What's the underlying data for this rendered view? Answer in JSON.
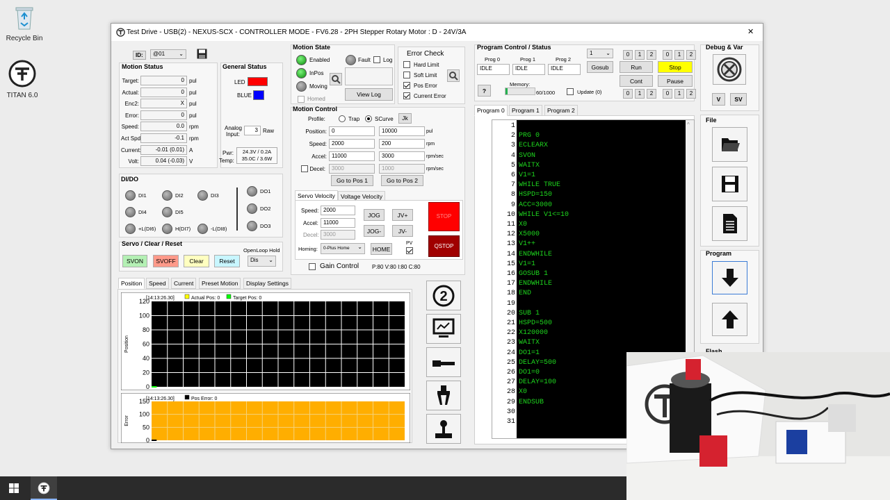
{
  "desktop": {
    "recycle_bin": "Recycle Bin",
    "titan": "TITAN 6.0"
  },
  "window": {
    "title": "Test Drive - USB(2) - NEXUS-SCX - CONTROLLER MODE - FV6.28 -  2PH Stepper Rotary Motor : D - 24V/3A",
    "close_glyph": "✕"
  },
  "id_box": {
    "label": "ID:",
    "value": "@01"
  },
  "motion_status": {
    "title": "Motion Status",
    "rows": [
      {
        "label": "Target:",
        "value": "0",
        "unit": "pul"
      },
      {
        "label": "Actual:",
        "value": "0",
        "unit": "pul"
      },
      {
        "label": "Enc2:",
        "value": "X",
        "unit": "pul"
      },
      {
        "label": "Error:",
        "value": "0",
        "unit": "pul"
      },
      {
        "label": "Speed:",
        "value": "0.0",
        "unit": "rpm"
      },
      {
        "label": "Act Spd:",
        "value": "-0.1",
        "unit": "rpm"
      },
      {
        "label": "Current:",
        "value": "-0.01 (0.01)",
        "unit": "A"
      },
      {
        "label": "Volt:",
        "value": "0.04 (-0.03)",
        "unit": "V"
      }
    ]
  },
  "general_status": {
    "title": "General Status",
    "led_label": "LED",
    "blue_label": "BLUE",
    "led_color": "#ff0000",
    "blue_color": "#0000ff",
    "analog_label": "Analog Input:",
    "analog_value": "3",
    "analog_unit": "Raw",
    "pwr_label": "Pwr:",
    "temp_label": "Temp:",
    "pwr_value": "24.3V / 0.2A",
    "temp_value": "35.0C / 3.6W"
  },
  "dido": {
    "title": "DI/DO",
    "inputs": [
      "DI1",
      "DI2",
      "DI3",
      "DI4",
      "DI5",
      "+L(DI6)",
      "H(DI7)",
      "-L(DI8)"
    ],
    "outputs": [
      "DO1",
      "DO2",
      "DO3"
    ]
  },
  "servo": {
    "title": "Servo / Clear / Reset",
    "svon": "SVON",
    "svoff": "SVOFF",
    "clear": "Clear",
    "reset": "Reset",
    "openloop_label": "OpenLoop Hold",
    "openloop_value": "Dis"
  },
  "motion_state": {
    "title": "Motion State",
    "enabled": "Enabled",
    "inpos": "InPos",
    "moving": "Moving",
    "homed": "Homed",
    "fault": "Fault",
    "log": "Log",
    "view_log": "View Log"
  },
  "error_check": {
    "title": "Error Check",
    "items": [
      {
        "label": "Hard Limit",
        "checked": false
      },
      {
        "label": "Soft Limit",
        "checked": false
      },
      {
        "label": "Pos Error",
        "checked": true
      },
      {
        "label": "Current Error",
        "checked": true
      }
    ]
  },
  "motion_control": {
    "title": "Motion Control",
    "profile_label": "Profile:",
    "trap": "Trap",
    "scurve": "SCurve",
    "jk": "Jk",
    "rows": [
      {
        "label": "Position:",
        "v1": "0",
        "v2": "10000",
        "unit": "pul"
      },
      {
        "label": "Speed:",
        "v1": "2000",
        "v2": "200",
        "unit": "rpm"
      },
      {
        "label": "Accel:",
        "v1": "11000",
        "v2": "3000",
        "unit": "rpm/sec"
      },
      {
        "label": "Decel:",
        "v1": "3000",
        "v2": "1000",
        "unit": "rpm/sec"
      }
    ],
    "goto1": "Go to Pos 1",
    "goto2": "Go to Pos 2"
  },
  "velocity": {
    "tab_servo": "Servo Velocity",
    "tab_voltage": "Voltage Velocity",
    "speed_label": "Speed:",
    "speed_value": "2000",
    "accel_label": "Accel:",
    "accel_value": "11000",
    "decel_label": "Decel:",
    "decel_value": "3000",
    "jog": "JOG",
    "jog_neg": "JOG-",
    "jv_pos": "JV+",
    "jv_neg": "JV-",
    "homing_label": "Homing:",
    "homing_value": "0-Plus Home",
    "home": "HOME",
    "pv": "PV",
    "stop": "STOP",
    "qstop": "QSTOP",
    "gain_control": "Gain Control",
    "pid": "P:80 V:80 I:80 C:80"
  },
  "chart_tabs": [
    "Position",
    "Speed",
    "Current",
    "Preset Motion",
    "Display Settings"
  ],
  "chart_data": [
    {
      "type": "line",
      "title": "[14:13:26.30]",
      "ylabel": "Position",
      "ylim": [
        0,
        120
      ],
      "yticks": [
        "120",
        "100",
        "80",
        "60",
        "40",
        "20",
        "0"
      ],
      "series": [
        {
          "name": "Actual Pos: 0",
          "color": "#ffff00",
          "values": [
            0,
            0
          ]
        },
        {
          "name": "Target Pos: 0",
          "color": "#00ff00",
          "values": [
            0,
            0
          ]
        }
      ]
    },
    {
      "type": "area",
      "title": "[14:13:26.30]",
      "ylabel": "Error",
      "ylim": [
        0,
        150
      ],
      "yticks": [
        "150",
        "100",
        "50",
        "0"
      ],
      "series": [
        {
          "name": "Pos Error: 0",
          "color": "#000000",
          "values": [
            0,
            0
          ]
        }
      ]
    }
  ],
  "program_control": {
    "title": "Program Control / Status",
    "progs": [
      {
        "label": "Prog 0",
        "status": "IDLE"
      },
      {
        "label": "Prog 1",
        "status": "IDLE"
      },
      {
        "label": "Prog 2",
        "status": "IDLE"
      }
    ],
    "select_value": "1",
    "gosub": "Gosub",
    "run": "Run",
    "stop": "Stop",
    "cont": "Cont",
    "pause": "Pause",
    "memory_label": "Memory:",
    "memory_value": "60/1000",
    "memory_fraction": 0.06,
    "update_label": "Update (0)",
    "help": "?",
    "digits": [
      "0",
      "1",
      "2"
    ]
  },
  "program_tabs": [
    "Program 0",
    "Program 1",
    "Program 2"
  ],
  "code_lines": [
    {
      "n": "1",
      "t": ""
    },
    {
      "n": "2",
      "t": "PRG 0"
    },
    {
      "n": "3",
      "t": "ECLEARX"
    },
    {
      "n": "4",
      "t": "SVON"
    },
    {
      "n": "5",
      "t": "WAITX"
    },
    {
      "n": "6",
      "t": "V1=1"
    },
    {
      "n": "7",
      "t": "WHILE TRUE"
    },
    {
      "n": "8",
      "t": "HSPD=150"
    },
    {
      "n": "9",
      "t": "ACC=3000"
    },
    {
      "n": "10",
      "t": "WHILE V1<=10"
    },
    {
      "n": "11",
      "t": "X0"
    },
    {
      "n": "12",
      "t": "X5000"
    },
    {
      "n": "13",
      "t": "V1++"
    },
    {
      "n": "14",
      "t": "ENDWHILE"
    },
    {
      "n": "15",
      "t": "V1=1"
    },
    {
      "n": "16",
      "t": "GOSUB 1"
    },
    {
      "n": "17",
      "t": "ENDWHILE"
    },
    {
      "n": "18",
      "t": "END"
    },
    {
      "n": "19",
      "t": ""
    },
    {
      "n": "20",
      "t": "SUB 1"
    },
    {
      "n": "21",
      "t": "HSPD=500"
    },
    {
      "n": "22",
      "t": "X120000"
    },
    {
      "n": "23",
      "t": "WAITX"
    },
    {
      "n": "24",
      "t": "DO1=1"
    },
    {
      "n": "25",
      "t": "DELAY=500"
    },
    {
      "n": "26",
      "t": "DO1=0"
    },
    {
      "n": "27",
      "t": "DELAY=100"
    },
    {
      "n": "28",
      "t": "X0"
    },
    {
      "n": "29",
      "t": "ENDSUB"
    },
    {
      "n": "30",
      "t": ""
    },
    {
      "n": "31",
      "t": ""
    }
  ],
  "debug": {
    "title": "Debug & Var",
    "v": "V",
    "sv": "SV"
  },
  "file": {
    "title": "File"
  },
  "program_side": {
    "title": "Program",
    "flash": "Flash"
  }
}
